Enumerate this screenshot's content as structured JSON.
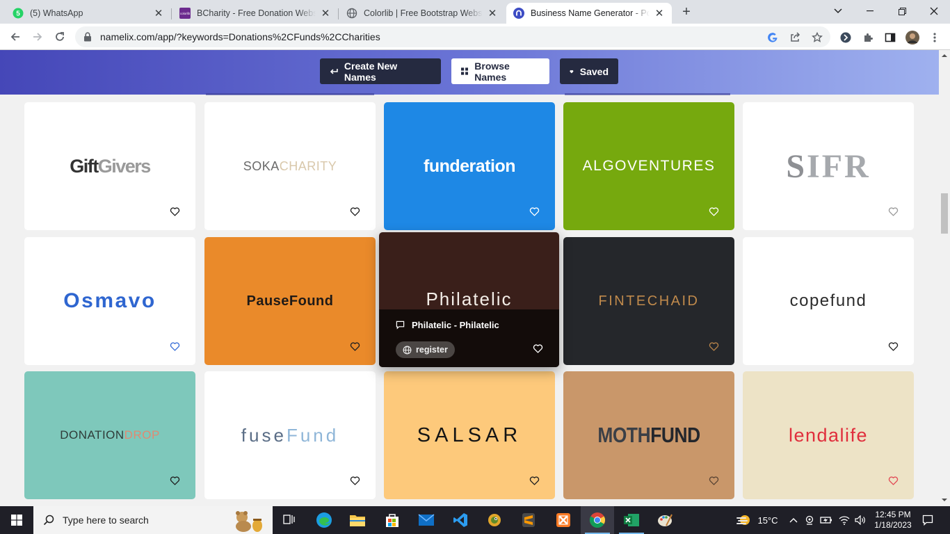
{
  "browser": {
    "tabs": [
      {
        "title": "(5) WhatsApp",
        "favicon": "whatsapp-icon",
        "badge": "5"
      },
      {
        "title": "BCharity - Free Donation Website",
        "favicon": "colorlib-icon"
      },
      {
        "title": "Colorlib | Free Bootstrap Website",
        "favicon": "globe-icon"
      },
      {
        "title": "Business Name Generator - Powe",
        "favicon": "namelix-icon",
        "active": true
      }
    ],
    "colorlib_label": "colorlib",
    "url": "namelix.com/app/?keywords=Donations%2CFunds%2CCharities"
  },
  "header": {
    "create_label": "Create New Names",
    "browse_label": "Browse Names",
    "saved_label": "Saved"
  },
  "names": [
    {
      "name": "GiftGivers",
      "part1": "Gift",
      "part2": "Givers",
      "bg": "#ffffff",
      "heart": "#202020"
    },
    {
      "name": "SOKACHARITY",
      "part1": "SOKA",
      "part2": "CHARITY",
      "bg": "#ffffff",
      "heart": "#202020"
    },
    {
      "name": "funderation",
      "part1": "funderation",
      "part2": "",
      "bg": "#1e88e5",
      "heart": "#ffffff"
    },
    {
      "name": "ALGOVENTURES",
      "part1": "ALGOVENTURES",
      "part2": "",
      "bg": "#76a90e",
      "heart": "#ffffff"
    },
    {
      "name": "SIFR",
      "part1": "S",
      "part2": "IFR",
      "bg": "#ffffff",
      "heart": "#9a9a9a"
    },
    {
      "name": "Osmavo",
      "part1": "Osmavo",
      "part2": "",
      "bg": "#ffffff",
      "heart": "#3a6fd8"
    },
    {
      "name": "PauseFound",
      "part1": "PauseFound",
      "part2": "",
      "bg": "#ea8a2a",
      "heart": "#202020"
    },
    {
      "name": "Philatelic",
      "part1": "Philatelic",
      "part2": "",
      "bg": "#3a1f1a",
      "heart": "#ffffff",
      "hover_text": "Philatelic - Philatelic",
      "register_label": "register"
    },
    {
      "name": "FINTECHAID",
      "part1": "FINTECHAID",
      "part2": "",
      "bg": "#25272b",
      "heart": "#b8844a"
    },
    {
      "name": "copefund",
      "part1": "copefund",
      "part2": "",
      "bg": "#ffffff",
      "heart": "#202020"
    },
    {
      "name": "DONATIONDROP",
      "part1": "DONATION",
      "part2": "DROP",
      "bg": "#7ec8bb",
      "heart": "#202020"
    },
    {
      "name": "fuseFund",
      "part1": "fuse",
      "part2": "Fund",
      "bg": "#ffffff",
      "heart": "#202020"
    },
    {
      "name": "SALSAR",
      "part1": "SALSAR",
      "part2": "",
      "bg": "#fdc97b",
      "heart": "#202020"
    },
    {
      "name": "MOTHFUND",
      "part1": "MOTH",
      "part2": "FUND",
      "bg": "#c9976a",
      "heart": "#5a4434"
    },
    {
      "name": "lendalife",
      "part1": "lendalife",
      "part2": "",
      "bg": "#ede3c6",
      "heart": "#e24a55"
    }
  ],
  "taskbar": {
    "search_placeholder": "Type here to search",
    "weather": "15°C",
    "time": "12:45 PM",
    "date": "1/18/2023"
  }
}
